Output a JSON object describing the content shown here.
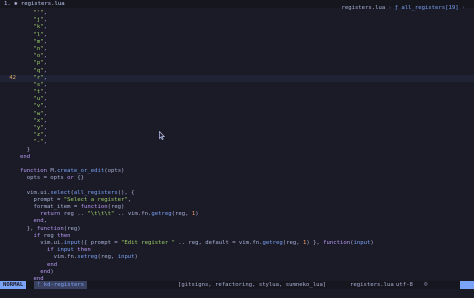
{
  "tabline": {
    "active_tab": "1. ✱ registers.lua"
  },
  "winbar": {
    "file": "registers.lua",
    "separator": "›",
    "symbol": "ƒ all_registers[19]",
    "symbol_tail": "›"
  },
  "editor": {
    "current_line_number": "42",
    "lines": [
      {
        "ln": "",
        "code": "    \"'\","
      },
      {
        "ln": "",
        "code": "    \"j\","
      },
      {
        "ln": "",
        "code": "    \"k\","
      },
      {
        "ln": "",
        "code": "    \"l\","
      },
      {
        "ln": "",
        "code": "    \"m\","
      },
      {
        "ln": "",
        "code": "    \"n\","
      },
      {
        "ln": "",
        "code": "    \"o\","
      },
      {
        "ln": "",
        "code": "    \"p\","
      },
      {
        "ln": "",
        "code": "    \"q\","
      },
      {
        "ln": "42",
        "code": "    \"r\","
      },
      {
        "ln": "",
        "code": "    \"s\","
      },
      {
        "ln": "",
        "code": "    \"t\","
      },
      {
        "ln": "",
        "code": "    \"u\","
      },
      {
        "ln": "",
        "code": "    \"v\","
      },
      {
        "ln": "",
        "code": "    \"w\","
      },
      {
        "ln": "",
        "code": "    \"x\","
      },
      {
        "ln": "",
        "code": "    \"y\","
      },
      {
        "ln": "",
        "code": "    \"z\","
      },
      {
        "ln": "",
        "code": "    \"-\","
      },
      {
        "ln": "",
        "code": "  }"
      },
      {
        "ln": "",
        "code": "end"
      },
      {
        "ln": "",
        "code": ""
      },
      {
        "ln": "",
        "code": "function M.create_or_edit(opts)"
      },
      {
        "ln": "",
        "code": "  opts = opts or {}"
      },
      {
        "ln": "",
        "code": ""
      },
      {
        "ln": "",
        "code": "  vim.ui.select(all_registers(), {"
      },
      {
        "ln": "",
        "code": "    prompt = \"Select a register\","
      },
      {
        "ln": "",
        "code": "    format_item = function(reg)"
      },
      {
        "ln": "",
        "code": "      return reg .. \"\\t\\t\\t\" .. vim.fn.getreg(reg, 1)"
      },
      {
        "ln": "",
        "code": "    end,"
      },
      {
        "ln": "",
        "code": "  }, function(reg)"
      },
      {
        "ln": "",
        "code": "    if reg then"
      },
      {
        "ln": "",
        "code": "      vim.ui.input({ prompt = \"Edit register \" .. reg, default = vim.fn.getreg(reg, 1) }, function(input)"
      },
      {
        "ln": "",
        "code": "        if input then"
      },
      {
        "ln": "",
        "code": "          vim.fn.setreg(reg, input)"
      },
      {
        "ln": "",
        "code": "        end"
      },
      {
        "ln": "",
        "code": "      end)"
      },
      {
        "ln": "",
        "code": "    end"
      },
      {
        "ln": "",
        "code": "  end)"
      },
      {
        "ln": "",
        "code": "end"
      }
    ]
  },
  "statusline": {
    "mode": "NORMAL",
    "branch": "ᚠ kd-registers",
    "lsp": "[gitsigns, refactoring, stylua, sumneko_lua]",
    "file": "registers.lua",
    "encoding": "utf-8",
    "format": "☺"
  },
  "colors": {
    "background": "#1a1b26",
    "keyword": "#bb9af7",
    "function": "#7aa2f7",
    "string": "#9ece6a",
    "number": "#ff9e64",
    "mode_bg": "#7aa2f7"
  }
}
